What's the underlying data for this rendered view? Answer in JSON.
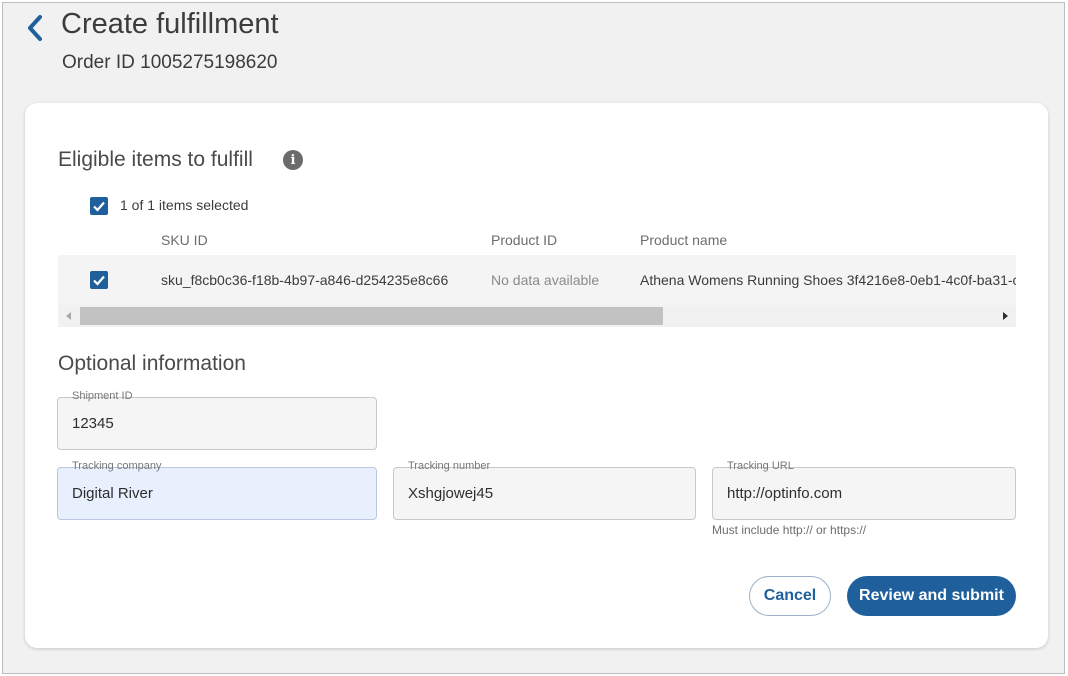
{
  "header": {
    "title": "Create fulfillment",
    "order_id": "Order ID 1005275198620"
  },
  "eligible": {
    "title": "Eligible items to fulfill",
    "selected_count": "1 of 1 items selected",
    "columns": [
      "SKU ID",
      "Product ID",
      "Product name"
    ],
    "rows": [
      {
        "sku_id": "sku_f8cb0c36-f18b-4b97-a846-d254235e8c66",
        "product_id": "No data available",
        "product_name": "Athena Womens Running Shoes 3f4216e8-0eb1-4c0f-ba31-c"
      }
    ]
  },
  "optional": {
    "title": "Optional information",
    "shipment_id": {
      "label": "Shipment ID",
      "value": "12345"
    },
    "tracking_company": {
      "label": "Tracking company",
      "value": "Digital River"
    },
    "tracking_number": {
      "label": "Tracking number",
      "value": "Xshgjowej45"
    },
    "tracking_url": {
      "label": "Tracking URL",
      "value": "http://optinfo.com",
      "helper": "Must include http:// or https://"
    }
  },
  "actions": {
    "cancel": "Cancel",
    "submit": "Review and submit"
  },
  "colors": {
    "accent": "#1f5f9b",
    "active_field": "#e8f0fd",
    "page_bg": "#f1f1f1"
  },
  "icons": {
    "back": "chevron-left-icon",
    "info": "info-icon",
    "check": "checkmark-icon"
  }
}
